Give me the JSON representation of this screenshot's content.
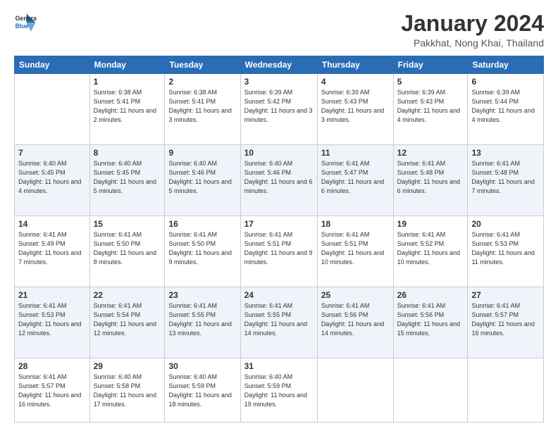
{
  "header": {
    "logo_line1": "General",
    "logo_line2": "Blue",
    "month_title": "January 2024",
    "subtitle": "Pakkhat, Nong Khai, Thailand"
  },
  "days_of_week": [
    "Sunday",
    "Monday",
    "Tuesday",
    "Wednesday",
    "Thursday",
    "Friday",
    "Saturday"
  ],
  "weeks": [
    [
      {
        "day": "",
        "sunrise": "",
        "sunset": "",
        "daylight": ""
      },
      {
        "day": "1",
        "sunrise": "Sunrise: 6:38 AM",
        "sunset": "Sunset: 5:41 PM",
        "daylight": "Daylight: 11 hours and 2 minutes."
      },
      {
        "day": "2",
        "sunrise": "Sunrise: 6:38 AM",
        "sunset": "Sunset: 5:41 PM",
        "daylight": "Daylight: 11 hours and 3 minutes."
      },
      {
        "day": "3",
        "sunrise": "Sunrise: 6:39 AM",
        "sunset": "Sunset: 5:42 PM",
        "daylight": "Daylight: 11 hours and 3 minutes."
      },
      {
        "day": "4",
        "sunrise": "Sunrise: 6:39 AM",
        "sunset": "Sunset: 5:43 PM",
        "daylight": "Daylight: 11 hours and 3 minutes."
      },
      {
        "day": "5",
        "sunrise": "Sunrise: 6:39 AM",
        "sunset": "Sunset: 5:43 PM",
        "daylight": "Daylight: 11 hours and 4 minutes."
      },
      {
        "day": "6",
        "sunrise": "Sunrise: 6:39 AM",
        "sunset": "Sunset: 5:44 PM",
        "daylight": "Daylight: 11 hours and 4 minutes."
      }
    ],
    [
      {
        "day": "7",
        "sunrise": "Sunrise: 6:40 AM",
        "sunset": "Sunset: 5:45 PM",
        "daylight": "Daylight: 11 hours and 4 minutes."
      },
      {
        "day": "8",
        "sunrise": "Sunrise: 6:40 AM",
        "sunset": "Sunset: 5:45 PM",
        "daylight": "Daylight: 11 hours and 5 minutes."
      },
      {
        "day": "9",
        "sunrise": "Sunrise: 6:40 AM",
        "sunset": "Sunset: 5:46 PM",
        "daylight": "Daylight: 11 hours and 5 minutes."
      },
      {
        "day": "10",
        "sunrise": "Sunrise: 6:40 AM",
        "sunset": "Sunset: 5:46 PM",
        "daylight": "Daylight: 11 hours and 6 minutes."
      },
      {
        "day": "11",
        "sunrise": "Sunrise: 6:41 AM",
        "sunset": "Sunset: 5:47 PM",
        "daylight": "Daylight: 11 hours and 6 minutes."
      },
      {
        "day": "12",
        "sunrise": "Sunrise: 6:41 AM",
        "sunset": "Sunset: 5:48 PM",
        "daylight": "Daylight: 11 hours and 6 minutes."
      },
      {
        "day": "13",
        "sunrise": "Sunrise: 6:41 AM",
        "sunset": "Sunset: 5:48 PM",
        "daylight": "Daylight: 11 hours and 7 minutes."
      }
    ],
    [
      {
        "day": "14",
        "sunrise": "Sunrise: 6:41 AM",
        "sunset": "Sunset: 5:49 PM",
        "daylight": "Daylight: 11 hours and 7 minutes."
      },
      {
        "day": "15",
        "sunrise": "Sunrise: 6:41 AM",
        "sunset": "Sunset: 5:50 PM",
        "daylight": "Daylight: 11 hours and 8 minutes."
      },
      {
        "day": "16",
        "sunrise": "Sunrise: 6:41 AM",
        "sunset": "Sunset: 5:50 PM",
        "daylight": "Daylight: 11 hours and 9 minutes."
      },
      {
        "day": "17",
        "sunrise": "Sunrise: 6:41 AM",
        "sunset": "Sunset: 5:51 PM",
        "daylight": "Daylight: 11 hours and 9 minutes."
      },
      {
        "day": "18",
        "sunrise": "Sunrise: 6:41 AM",
        "sunset": "Sunset: 5:51 PM",
        "daylight": "Daylight: 11 hours and 10 minutes."
      },
      {
        "day": "19",
        "sunrise": "Sunrise: 6:41 AM",
        "sunset": "Sunset: 5:52 PM",
        "daylight": "Daylight: 11 hours and 10 minutes."
      },
      {
        "day": "20",
        "sunrise": "Sunrise: 6:41 AM",
        "sunset": "Sunset: 5:53 PM",
        "daylight": "Daylight: 11 hours and 11 minutes."
      }
    ],
    [
      {
        "day": "21",
        "sunrise": "Sunrise: 6:41 AM",
        "sunset": "Sunset: 5:53 PM",
        "daylight": "Daylight: 11 hours and 12 minutes."
      },
      {
        "day": "22",
        "sunrise": "Sunrise: 6:41 AM",
        "sunset": "Sunset: 5:54 PM",
        "daylight": "Daylight: 11 hours and 12 minutes."
      },
      {
        "day": "23",
        "sunrise": "Sunrise: 6:41 AM",
        "sunset": "Sunset: 5:55 PM",
        "daylight": "Daylight: 11 hours and 13 minutes."
      },
      {
        "day": "24",
        "sunrise": "Sunrise: 6:41 AM",
        "sunset": "Sunset: 5:55 PM",
        "daylight": "Daylight: 11 hours and 14 minutes."
      },
      {
        "day": "25",
        "sunrise": "Sunrise: 6:41 AM",
        "sunset": "Sunset: 5:56 PM",
        "daylight": "Daylight: 11 hours and 14 minutes."
      },
      {
        "day": "26",
        "sunrise": "Sunrise: 6:41 AM",
        "sunset": "Sunset: 5:56 PM",
        "daylight": "Daylight: 11 hours and 15 minutes."
      },
      {
        "day": "27",
        "sunrise": "Sunrise: 6:41 AM",
        "sunset": "Sunset: 5:57 PM",
        "daylight": "Daylight: 11 hours and 16 minutes."
      }
    ],
    [
      {
        "day": "28",
        "sunrise": "Sunrise: 6:41 AM",
        "sunset": "Sunset: 5:57 PM",
        "daylight": "Daylight: 11 hours and 16 minutes."
      },
      {
        "day": "29",
        "sunrise": "Sunrise: 6:40 AM",
        "sunset": "Sunset: 5:58 PM",
        "daylight": "Daylight: 11 hours and 17 minutes."
      },
      {
        "day": "30",
        "sunrise": "Sunrise: 6:40 AM",
        "sunset": "Sunset: 5:59 PM",
        "daylight": "Daylight: 11 hours and 18 minutes."
      },
      {
        "day": "31",
        "sunrise": "Sunrise: 6:40 AM",
        "sunset": "Sunset: 5:59 PM",
        "daylight": "Daylight: 11 hours and 19 minutes."
      },
      {
        "day": "",
        "sunrise": "",
        "sunset": "",
        "daylight": ""
      },
      {
        "day": "",
        "sunrise": "",
        "sunset": "",
        "daylight": ""
      },
      {
        "day": "",
        "sunrise": "",
        "sunset": "",
        "daylight": ""
      }
    ]
  ]
}
